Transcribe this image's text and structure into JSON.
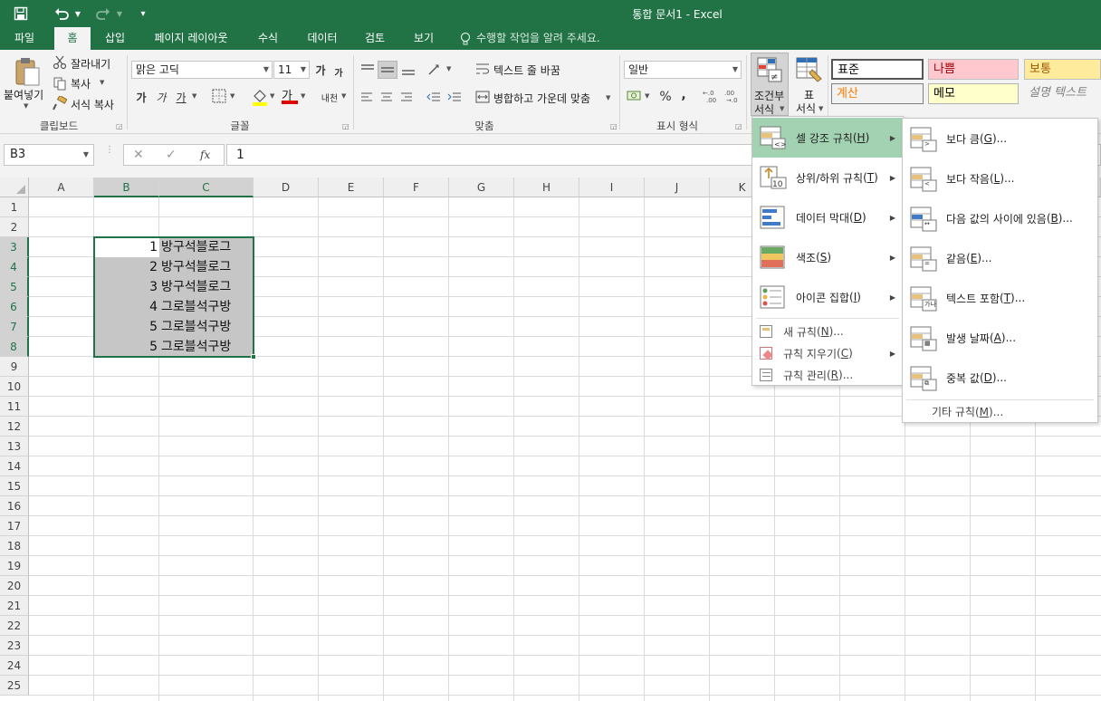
{
  "window": {
    "title": "통합 문서1 - Excel"
  },
  "tabs": [
    "파일",
    "홈",
    "삽입",
    "페이지 레이아웃",
    "수식",
    "데이터",
    "검토",
    "보기"
  ],
  "tell_me": "수행할 작업을 알려 주세요.",
  "ribbon": {
    "clipboard": {
      "paste": "붙여넣기",
      "cut": "잘라내기",
      "copy": "복사",
      "format_painter": "서식 복사",
      "label": "클립보드"
    },
    "font": {
      "name": "맑은 고딕",
      "size": "11",
      "label": "글꼴",
      "bold": "가",
      "italic": "가",
      "underline": "가",
      "grow": "가",
      "shrink": "가",
      "color_a": "가",
      "phonetic": "내천"
    },
    "alignment": {
      "wrap": "텍스트 줄 바꿈",
      "merge": "병합하고 가운데 맞춤",
      "label": "맞춤"
    },
    "number": {
      "format": "일반",
      "label": "표시 형식",
      "percent": "%",
      "comma": ",",
      "inc_dec": "←.0 .00",
      "dec_dec": ".00 →.0"
    },
    "styles": {
      "conditional_line1": "조건부",
      "conditional_line2": "서식",
      "table_line1": "표",
      "table_line2": "서식",
      "cells": [
        {
          "label": "표준",
          "bg": "#ffffff",
          "fg": "#000000"
        },
        {
          "label": "나쁨",
          "bg": "#ffc7ce",
          "fg": "#9c0006"
        },
        {
          "label": "보통",
          "bg": "#ffeb9c",
          "fg": "#9c5700"
        },
        {
          "label": "계산",
          "bg": "#f2f2f2",
          "fg": "#fa7d00"
        },
        {
          "label": "메모",
          "bg": "#ffffcc",
          "fg": "#000000"
        },
        {
          "label": "설명 텍스트",
          "bg": "#f3f3f3",
          "fg": "#7f7f7f"
        }
      ]
    }
  },
  "formula_bar": {
    "name_box": "B3",
    "cancel": "✕",
    "enter": "✓",
    "fx": "fx",
    "value": "1"
  },
  "columns": [
    "A",
    "B",
    "C",
    "D",
    "E",
    "F",
    "G",
    "H",
    "I",
    "J",
    "K"
  ],
  "rows": [
    "1",
    "2",
    "3",
    "4",
    "5",
    "6",
    "7",
    "8",
    "9",
    "10",
    "11",
    "12",
    "13",
    "14",
    "15",
    "16",
    "17",
    "18",
    "19",
    "20",
    "21",
    "22",
    "23",
    "24",
    "25"
  ],
  "cells": [
    {
      "b": "1",
      "c": "방구석블로그"
    },
    {
      "b": "2",
      "c": "방구석블로그"
    },
    {
      "b": "3",
      "c": "방구석블로그"
    },
    {
      "b": "4",
      "c": "그로블석구방"
    },
    {
      "b": "5",
      "c": "그로블석구방"
    },
    {
      "b": "5",
      "c": "그로블석구방"
    }
  ],
  "menu": {
    "items": [
      {
        "label": "셀 강조 규칙",
        "key": "H"
      },
      {
        "label": "상위/하위 규칙",
        "key": "T"
      },
      {
        "label": "데이터 막대",
        "key": "D"
      },
      {
        "label": "색조",
        "key": "S"
      },
      {
        "label": "아이콘 집합",
        "key": "I"
      }
    ],
    "small_items": [
      {
        "label": "새 규칙",
        "key": "N",
        "suffix": "..."
      },
      {
        "label": "규칙 지우기",
        "key": "C",
        "suffix": ""
      },
      {
        "label": "규칙 관리",
        "key": "R",
        "suffix": "..."
      }
    ]
  },
  "submenu": {
    "items": [
      {
        "label": "보다 큼",
        "key": "G"
      },
      {
        "label": "보다 작음",
        "key": "L"
      },
      {
        "label": "다음 값의 사이에 있음",
        "key": "B"
      },
      {
        "label": "같음",
        "key": "E"
      },
      {
        "label": "텍스트 포함",
        "key": "T"
      },
      {
        "label": "발생 날짜",
        "key": "A"
      },
      {
        "label": "중복 값",
        "key": "D"
      }
    ],
    "more": {
      "label": "기타 규칙",
      "key": "M"
    }
  },
  "colors": {
    "accent": "#217346",
    "highlight": "#a2d2b2",
    "selection": "#c6c6c6"
  }
}
